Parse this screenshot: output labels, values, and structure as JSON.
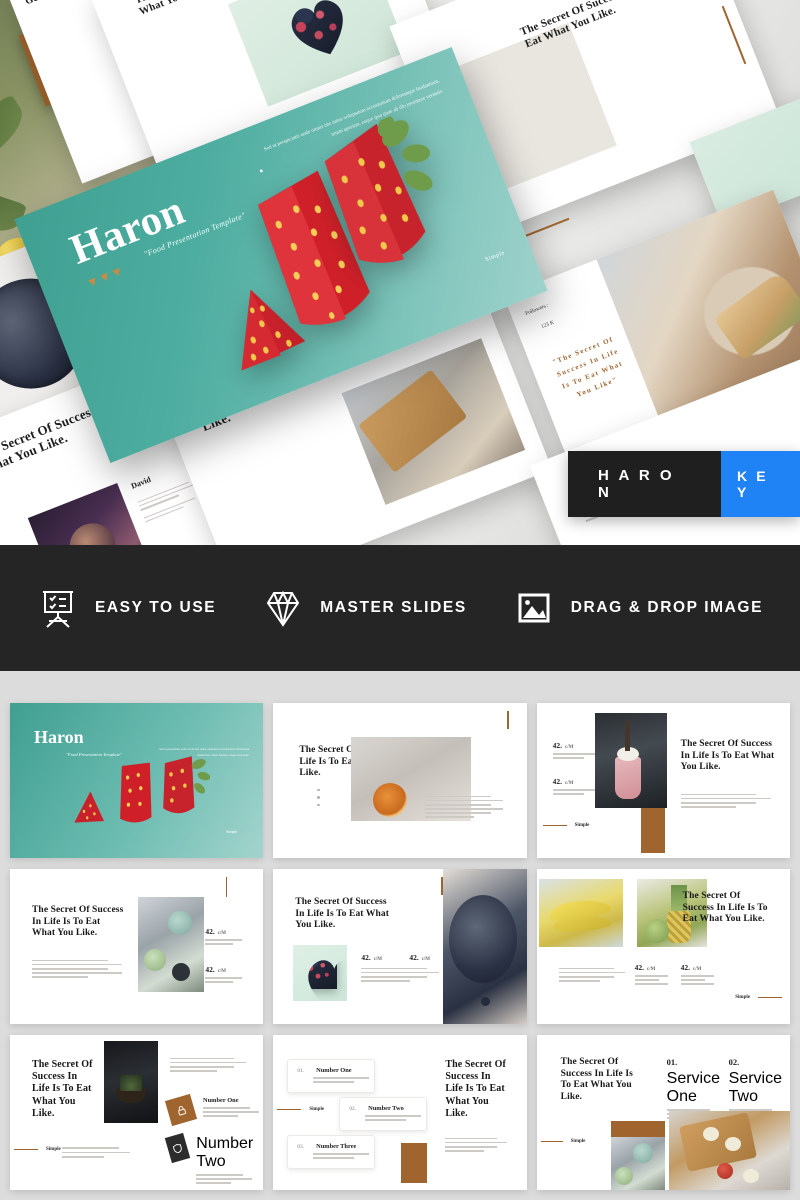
{
  "hero": {
    "title_slide": {
      "brand": "Haron",
      "tagline": "\"Food Presentation Template\"",
      "lead": "Sed ut perspiciatis unde omnis iste natus voluptatem accusantium doloremque laudantium, totam aperiam, eaque ipsa quae ab illo inventore veritatis.",
      "corner_label": "Simple"
    },
    "slides": {
      "secret_heading": "The Secret Of Success In Life Is To Eat What You Like.",
      "geoff_heading": "Geoff",
      "david_name": "David",
      "followers_label": "Followers :",
      "followers_value": "123 K",
      "quote": "\"The Secret Of Success In Life Is To Eat What You Like\"",
      "service_one_num": "01.",
      "service_one_label": "Service One",
      "service_two_num": "02.",
      "service_two_label": "Service Two",
      "number_two_num": "02.",
      "number_two_label": "Number Two",
      "simple_label": "Simple",
      "body_text": "Sed ut perspiciatis unde omnis iste natus voluptatem accusantium doloremque laudantium, totam aperiam, eaque ipsa quae."
    }
  },
  "logo_badge": {
    "name": "H A R O N",
    "format": "K E Y",
    "dark_color": "#1f1f1f",
    "accent_color": "#1f82f5"
  },
  "features": {
    "background": "#252525",
    "items": [
      {
        "icon": "presentation-board-icon",
        "label": "EASY TO USE"
      },
      {
        "icon": "diamond-icon",
        "label": "MASTER SLIDES"
      },
      {
        "icon": "image-frame-icon",
        "label": "DRAG & DROP IMAGE"
      }
    ]
  },
  "theme": {
    "teal": "#4dada0",
    "brown": "#a0652f",
    "dark": "#252525",
    "page_background": "#dcdcdc"
  },
  "thumbnails": [
    {
      "id": "slide-01-cover",
      "layout": "cover-teal",
      "brand": "Haron",
      "tagline": "\"Food Presentation Template\"",
      "lead": "Sed ut perspiciatis unde omnis iste natus voluptatem accusantium doloremque laudantium, totam aperiam, eaque ipsa quae.",
      "corner_label": "Simple"
    },
    {
      "id": "slide-02-citrus",
      "layout": "heading-left-photo-right",
      "heading": "The Secret Of Success In Life Is To Eat What You Like.",
      "body": "Sed ut perspiciatis unde omnis iste natus voluptatem accusantium doloremque laudantium, totam aperiam, eaque ipsa quae ab illo inventore veritatis et quasi architecto beatae vitae dicta sunt explicabo.",
      "photo": "hand-holding-citrus"
    },
    {
      "id": "slide-03-milkshake",
      "layout": "stats-left-photo-center-heading-right",
      "heading": "The Secret Of Success In Life Is To Eat What You Like.",
      "body": "Sed ut perspiciatis unde omnis iste natus voluptatem accusantium doloremque laudantium, totam aperiam, eaque ipsa quae ab illo inventore veritatis.",
      "stats": [
        {
          "value": "42.",
          "unit": "c/M",
          "note": "Sed ut perspiciatis unde omnis iste natus."
        },
        {
          "value": "42.",
          "unit": "c/M",
          "note": "Sed ut perspiciatis unde omnis iste natus."
        }
      ],
      "corner_label": "Simple",
      "photo": "chocolate-milkshake"
    },
    {
      "id": "slide-04-lime",
      "layout": "heading-left-photo-center-stats-right",
      "heading": "The Secret Of Success In Life Is To Eat What You Like.",
      "body": "Sed ut perspiciatis unde omnis iste natus voluptatem accusantium doloremque laudantium, totam aperiam, eaque ipsa quae ab illo inventore veritatis et quasi architecto.",
      "stats": [
        {
          "value": "42.",
          "unit": "c/M",
          "note": "Sed ut perspiciatis unde omnis iste natus."
        },
        {
          "value": "42.",
          "unit": "c/M",
          "note": "Sed ut perspiciatis unde omnis iste natus."
        }
      ],
      "photo": "lime-drinks-board"
    },
    {
      "id": "slide-05-blueberry",
      "layout": "heading-left-heart-stats-photo-right",
      "heading": "The Secret Of Success In Life Is To Eat What You Like.",
      "body": "Sed ut perspiciatis unde omnis iste natus voluptatem accusantium doloremque laudantium, totam aperiam, eaque ipsa quae ab illo inventore veritatis.",
      "stats": [
        {
          "value": "42.",
          "unit": "c/M"
        },
        {
          "value": "42.",
          "unit": "c/M"
        }
      ],
      "photo": "bowl-of-blueberries",
      "inset_photo": "heart-shaped-berries"
    },
    {
      "id": "slide-06-banana-pineapple",
      "layout": "two-photos-top-stats-bottom",
      "heading": "The Secret Of Success In Life Is To Eat What You Like.",
      "body": "Sed ut perspiciatis unde omnis iste natus voluptatem accusantium doloremque laudantium, totam aperiam, eaque ipsa quae ab illo inventore.",
      "stats": [
        {
          "value": "42.",
          "unit": "c/M",
          "note": "Sed ut perspiciatis unde omnis iste natus."
        },
        {
          "value": "42.",
          "unit": "c/M",
          "note": "Sed ut perspiciatis unde omnis iste natus."
        }
      ],
      "corner_label": "Simple",
      "photos": [
        "bananas",
        "pineapple-and-melon"
      ]
    },
    {
      "id": "slide-07-number-list",
      "layout": "heading-left-photo-center-numbered-right",
      "heading": "The Secret Of Success In Life Is To Eat What You Like.",
      "body": "Sed ut perspiciatis unde omnis iste natus voluptatem accusantium doloremque laudantium aperiam, eaque ipsa quae.",
      "items": [
        {
          "icon": "lock-icon",
          "title": "Number One",
          "text": "Sed ut perspiciatis unde omnis iste natus voluptatem accusantium doloremque."
        },
        {
          "icon": "shield-icon",
          "title": "Number Two",
          "text": "Sed ut perspiciatis unde omnis iste natus voluptatem accusantium doloremque."
        }
      ],
      "corner_label": "Simple",
      "photo": "dark-bonsai-bowl"
    },
    {
      "id": "slide-08-steps",
      "layout": "step-cards-left-heading-right",
      "heading": "The Secret Of Success In Life Is To Eat What You Like.",
      "body": "Sed ut perspiciatis unde omnis iste natus voluptatem accusantium doloremque laudantium, totam aperiam, eaque ipsa quae.",
      "steps": [
        {
          "num": "01.",
          "title": "Number One",
          "text": "Sed ut perspiciatis nmnulngitedt accusantium doloremque totam, loreprem eaque ipsa."
        },
        {
          "num": "02.",
          "title": "Number Two",
          "text": "Sed ut perspiciatis nmnulngitedt accusantium doloremque totam, loreprem eaque ipsa."
        },
        {
          "num": "03.",
          "title": "Number Three",
          "text": "Sed ut perspiciatis nmnulngitedt accusantium doloremque totam, loreprem eaque ipsa."
        }
      ],
      "corner_label": "Simple"
    },
    {
      "id": "slide-09-services",
      "layout": "heading-left-services-right-photos-bottom",
      "heading": "The Secret Of Success In Life Is To Eat What You Like.",
      "services": [
        {
          "num": "01.",
          "title": "Service One",
          "text": "Sed ut perspiciatis unde omnis iste natus voluptatem accusantium dolore neque laudan."
        },
        {
          "num": "02.",
          "title": "Service Two",
          "text": "Sed ut perspiciatis unde omnis iste natus voluptatem accusantium dolore neque laudan."
        }
      ],
      "corner_label": "Simple",
      "photos": [
        "lime-drinks-board",
        "apples-on-cutting-board"
      ]
    }
  ]
}
